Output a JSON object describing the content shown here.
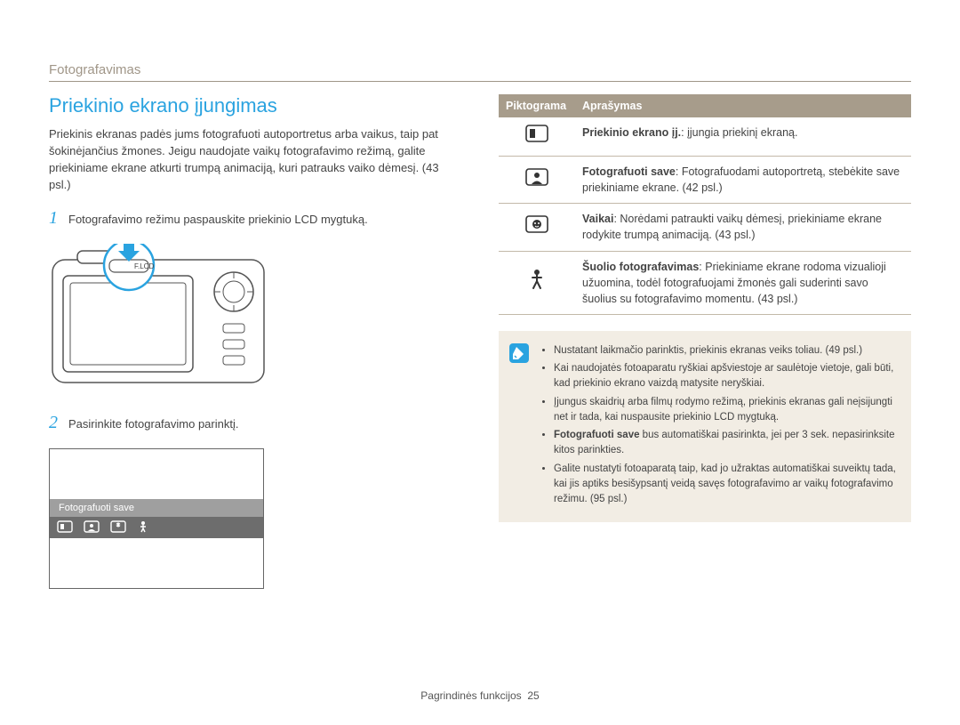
{
  "section": "Fotografavimas",
  "title": "Priekinio ekrano įjungimas",
  "intro": "Priekinis ekranas padės jums fotografuoti autoportretus arba vaikus, taip pat šokinėjančius žmones. Jeigu naudojate vaikų fotografavimo režimą, galite priekiniame ekrane atkurti trumpą animaciją, kuri patrauks vaiko dėmesį. (43 psl.)",
  "step1_num": "1",
  "step1": "Fotografavimo režimu paspauskite priekinio LCD mygtuką.",
  "camera_label": "F.LCD",
  "step2_num": "2",
  "step2": "Pasirinkite fotografavimo parinktį.",
  "screen_label": "Fotografuoti save",
  "table": {
    "head_icon": "Piktograma",
    "head_desc": "Aprašymas",
    "rows": [
      {
        "bold": "Priekinio ekrano įj.",
        "rest": ": įjungia priekinį ekraną."
      },
      {
        "bold": "Fotografuoti save",
        "rest": ": Fotografuodami autoportretą, stebėkite save priekiniame ekrane. (42 psl.)"
      },
      {
        "bold": "Vaikai",
        "rest": ": Norėdami patraukti vaikų dėmesį, priekiniame ekrane rodykite trumpą animaciją. (43 psl.)"
      },
      {
        "bold": "Šuolio fotografavimas",
        "rest": ": Priekiniame ekrane rodoma vizualioji užuomina, todėl fotografuojami žmonės gali suderinti savo šuolius su fotografavimo momentu. (43 psl.)"
      }
    ]
  },
  "info": [
    {
      "pre": "Nustatant laikmačio parinktis, priekinis ekranas veiks toliau. (49 psl.)"
    },
    {
      "pre": "Kai naudojatės fotoaparatu ryškiai apšviestoje ar saulėtoje vietoje, gali būti, kad priekinio ekrano vaizdą matysite neryškiai."
    },
    {
      "pre": "Įjungus skaidrių arba filmų rodymo režimą, priekinis ekranas gali neįsijungti net ir tada, kai nuspausite priekinio LCD mygtuką."
    },
    {
      "bold": "Fotografuoti save",
      "rest": " bus automatiškai pasirinkta, jei per 3 sek. nepasirinksite kitos parinkties."
    },
    {
      "pre": "Galite nustatyti fotoaparatą taip, kad jo užraktas automatiškai suveiktų tada, kai jis aptiks besišypsantį veidą savęs fotografavimo ar vaikų fotografavimo režimu. (95 psl.)"
    }
  ],
  "footer_label": "Pagrindinės funkcijos",
  "footer_page": "25"
}
